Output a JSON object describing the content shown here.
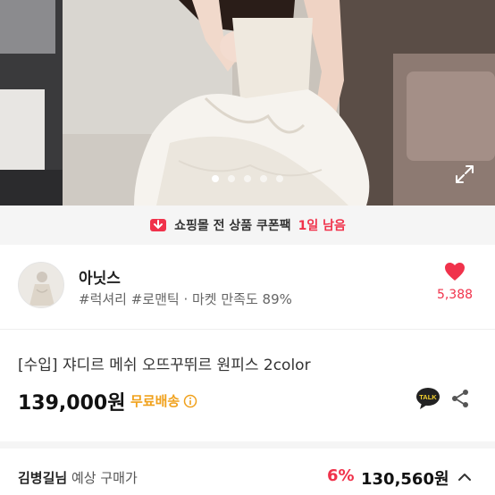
{
  "hero": {
    "image_description": "",
    "dots": [
      true,
      false,
      false,
      false,
      false
    ],
    "expand_icon": "expand-icon"
  },
  "banner": {
    "icon": "coupon-icon",
    "text": "쇼핑몰 전 상품 쿠폰팩",
    "highlight": "1일 남음"
  },
  "seller": {
    "name": "아닛스",
    "meta": "#럭셔리 #로맨틱 · 마켓 만족도 89%",
    "likes": "5,388"
  },
  "product": {
    "title": "[수입] 쟈디르 메쉬 오뜨꾸뛰르 원피스 2color",
    "price": "139,000원",
    "shipping": "무료배송"
  },
  "estimate": {
    "name": "김병길님",
    "label": " 예상 구매가",
    "rate": "6%",
    "price": "130,560원"
  },
  "colors": {
    "accent": "#f0324b",
    "shipping": "#f0a11c"
  }
}
